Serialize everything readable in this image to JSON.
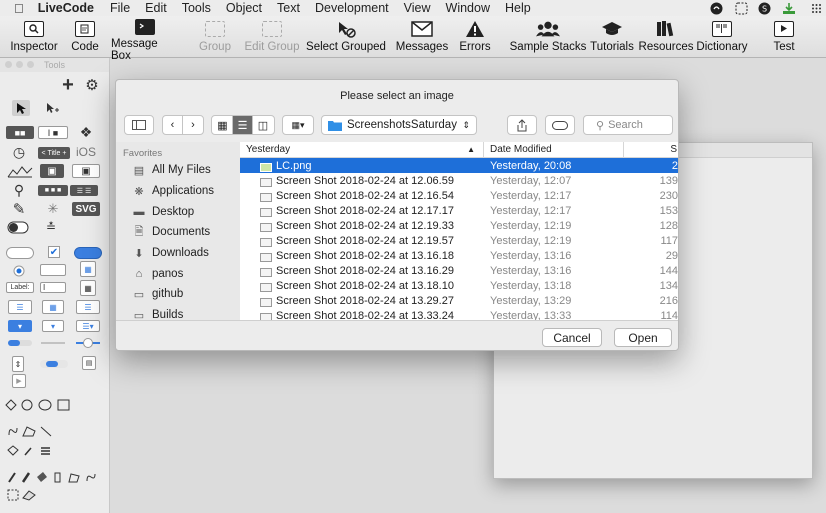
{
  "menubar": {
    "app_name": "LiveCode",
    "menus": [
      "File",
      "Edit",
      "Tools",
      "Object",
      "Text",
      "Development",
      "View",
      "Window",
      "Help"
    ]
  },
  "toolbar": {
    "items": [
      {
        "label": "Inspector",
        "icon": "inspector-icon",
        "enabled": true
      },
      {
        "label": "Code",
        "icon": "code-icon",
        "enabled": true
      },
      {
        "label": "Message Box",
        "icon": "message-box-icon",
        "enabled": true
      },
      {
        "label": "Group",
        "icon": "group-icon",
        "enabled": false
      },
      {
        "label": "Edit Group",
        "icon": "edit-group-icon",
        "enabled": false
      },
      {
        "label": "Select Grouped",
        "icon": "select-grouped-icon",
        "enabled": true
      },
      {
        "label": "Messages",
        "icon": "envelope-icon",
        "enabled": true
      },
      {
        "label": "Errors",
        "icon": "warning-icon",
        "enabled": true
      },
      {
        "label": "Sample Stacks",
        "icon": "people-icon",
        "enabled": true
      },
      {
        "label": "Tutorials",
        "icon": "graduation-cap-icon",
        "enabled": true
      },
      {
        "label": "Resources",
        "icon": "books-icon",
        "enabled": true
      },
      {
        "label": "Dictionary",
        "icon": "dictionary-icon",
        "enabled": true
      },
      {
        "label": "Test",
        "icon": "play-icon",
        "enabled": true
      }
    ]
  },
  "palette": {
    "title": "Tools",
    "widget_labels": {
      "title_plus": "< Title +",
      "ios": "iOS",
      "svg": "SVG",
      "label_field": "Label:"
    }
  },
  "dialog": {
    "title": "Please select an image",
    "location": "ScreenshotsSaturday",
    "search_placeholder": "Search",
    "sidebar": {
      "heading": "Favorites",
      "items": [
        {
          "label": "All My Files",
          "icon": "all-files-icon"
        },
        {
          "label": "Applications",
          "icon": "applications-icon"
        },
        {
          "label": "Desktop",
          "icon": "desktop-icon"
        },
        {
          "label": "Documents",
          "icon": "documents-icon"
        },
        {
          "label": "Downloads",
          "icon": "downloads-icon"
        },
        {
          "label": "panos",
          "icon": "home-icon"
        },
        {
          "label": "github",
          "icon": "folder-icon"
        },
        {
          "label": "Builds",
          "icon": "folder-icon"
        }
      ]
    },
    "columns": {
      "name": "Yesterday",
      "date": "Date Modified",
      "size": "S"
    },
    "files": [
      {
        "name": "LC.png",
        "date": "Yesterday, 20:08",
        "size": "2",
        "selected": true
      },
      {
        "name": "Screen Shot 2018-02-24 at 12.06.59",
        "date": "Yesterday, 12:07",
        "size": "139"
      },
      {
        "name": "Screen Shot 2018-02-24 at 12.16.54",
        "date": "Yesterday, 12:17",
        "size": "230"
      },
      {
        "name": "Screen Shot 2018-02-24 at 12.17.17",
        "date": "Yesterday, 12:17",
        "size": "153"
      },
      {
        "name": "Screen Shot 2018-02-24 at 12.19.33",
        "date": "Yesterday, 12:19",
        "size": "128"
      },
      {
        "name": "Screen Shot 2018-02-24 at 12.19.57",
        "date": "Yesterday, 12:19",
        "size": "117"
      },
      {
        "name": "Screen Shot 2018-02-24 at 13.16.18",
        "date": "Yesterday, 13:16",
        "size": "29"
      },
      {
        "name": "Screen Shot 2018-02-24 at 13.16.29",
        "date": "Yesterday, 13:16",
        "size": "144"
      },
      {
        "name": "Screen Shot 2018-02-24 at 13.18.10",
        "date": "Yesterday, 13:18",
        "size": "134"
      },
      {
        "name": "Screen Shot 2018-02-24 at 13.29.27",
        "date": "Yesterday, 13:29",
        "size": "216"
      },
      {
        "name": "Screen Shot 2018-02-24 at 13.33.24",
        "date": "Yesterday, 13:33",
        "size": "114"
      }
    ],
    "cancel_label": "Cancel",
    "open_label": "Open"
  },
  "colors": {
    "selection": "#1e6fd9",
    "folder": "#2f8fe6"
  }
}
